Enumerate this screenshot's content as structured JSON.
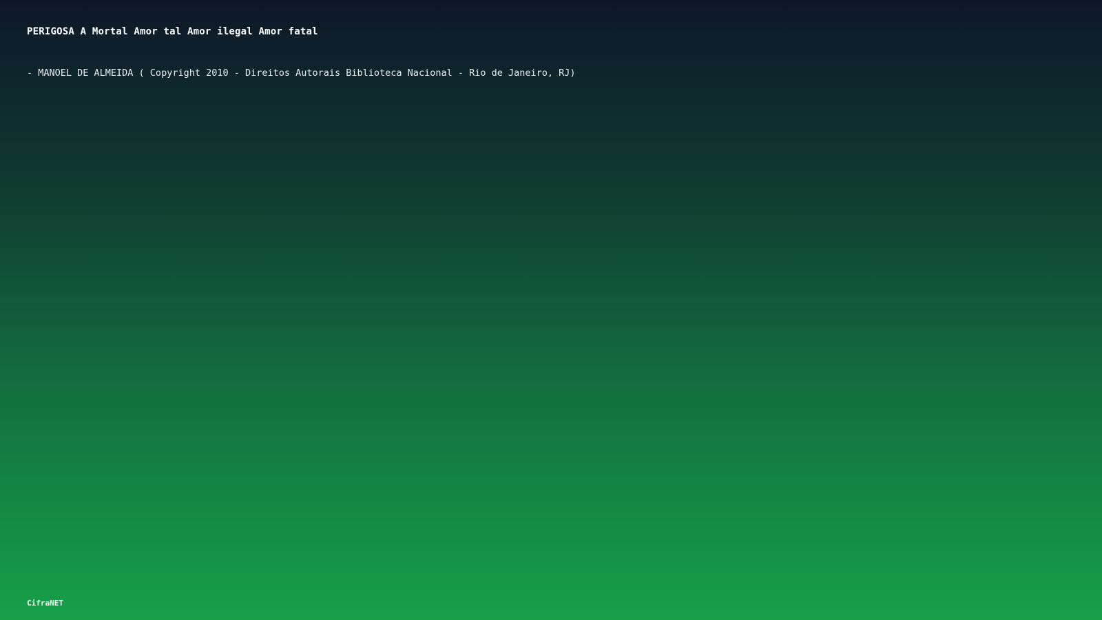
{
  "slide": {
    "title": "PERIGOSA A Mortal Amor tal Amor ilegal Amor fatal",
    "credit": "- MANOEL DE ALMEIDA ( Copyright 2010 - Direitos Autorais Biblioteca Nacional - Rio de Janeiro, RJ)"
  },
  "footer": {
    "brand": "CifraNET"
  },
  "colors": {
    "gradient_top": "#0e1729",
    "gradient_bottom": "#16a048",
    "text": "#ffffff"
  }
}
